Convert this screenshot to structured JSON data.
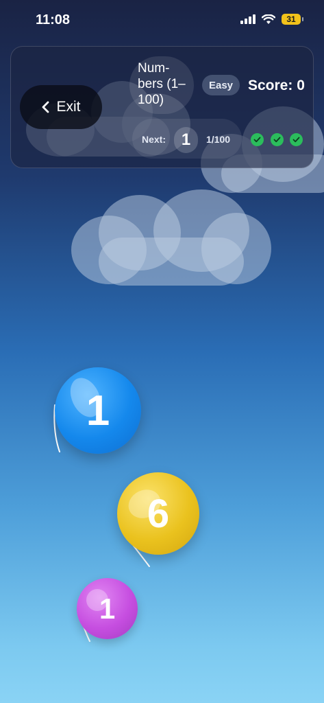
{
  "status_bar": {
    "time": "11:08",
    "battery_level": "31"
  },
  "header": {
    "exit_label": "Exit",
    "mode_title": "Num-\nbers (1–\n100)",
    "difficulty": "Easy",
    "score": "Score: 0",
    "next_label": "Next:",
    "next_number": "1",
    "progress": "1/100",
    "lives_remaining": 3
  },
  "balloons": [
    {
      "number": "1",
      "color": "#1488ec"
    },
    {
      "number": "6",
      "color": "#eac21e"
    },
    {
      "number": "1",
      "color": "#c64ee0"
    }
  ],
  "colors": {
    "check_green": "#2bbd5c",
    "panel_background": "#1c2440",
    "battery": "#f2c21b"
  }
}
